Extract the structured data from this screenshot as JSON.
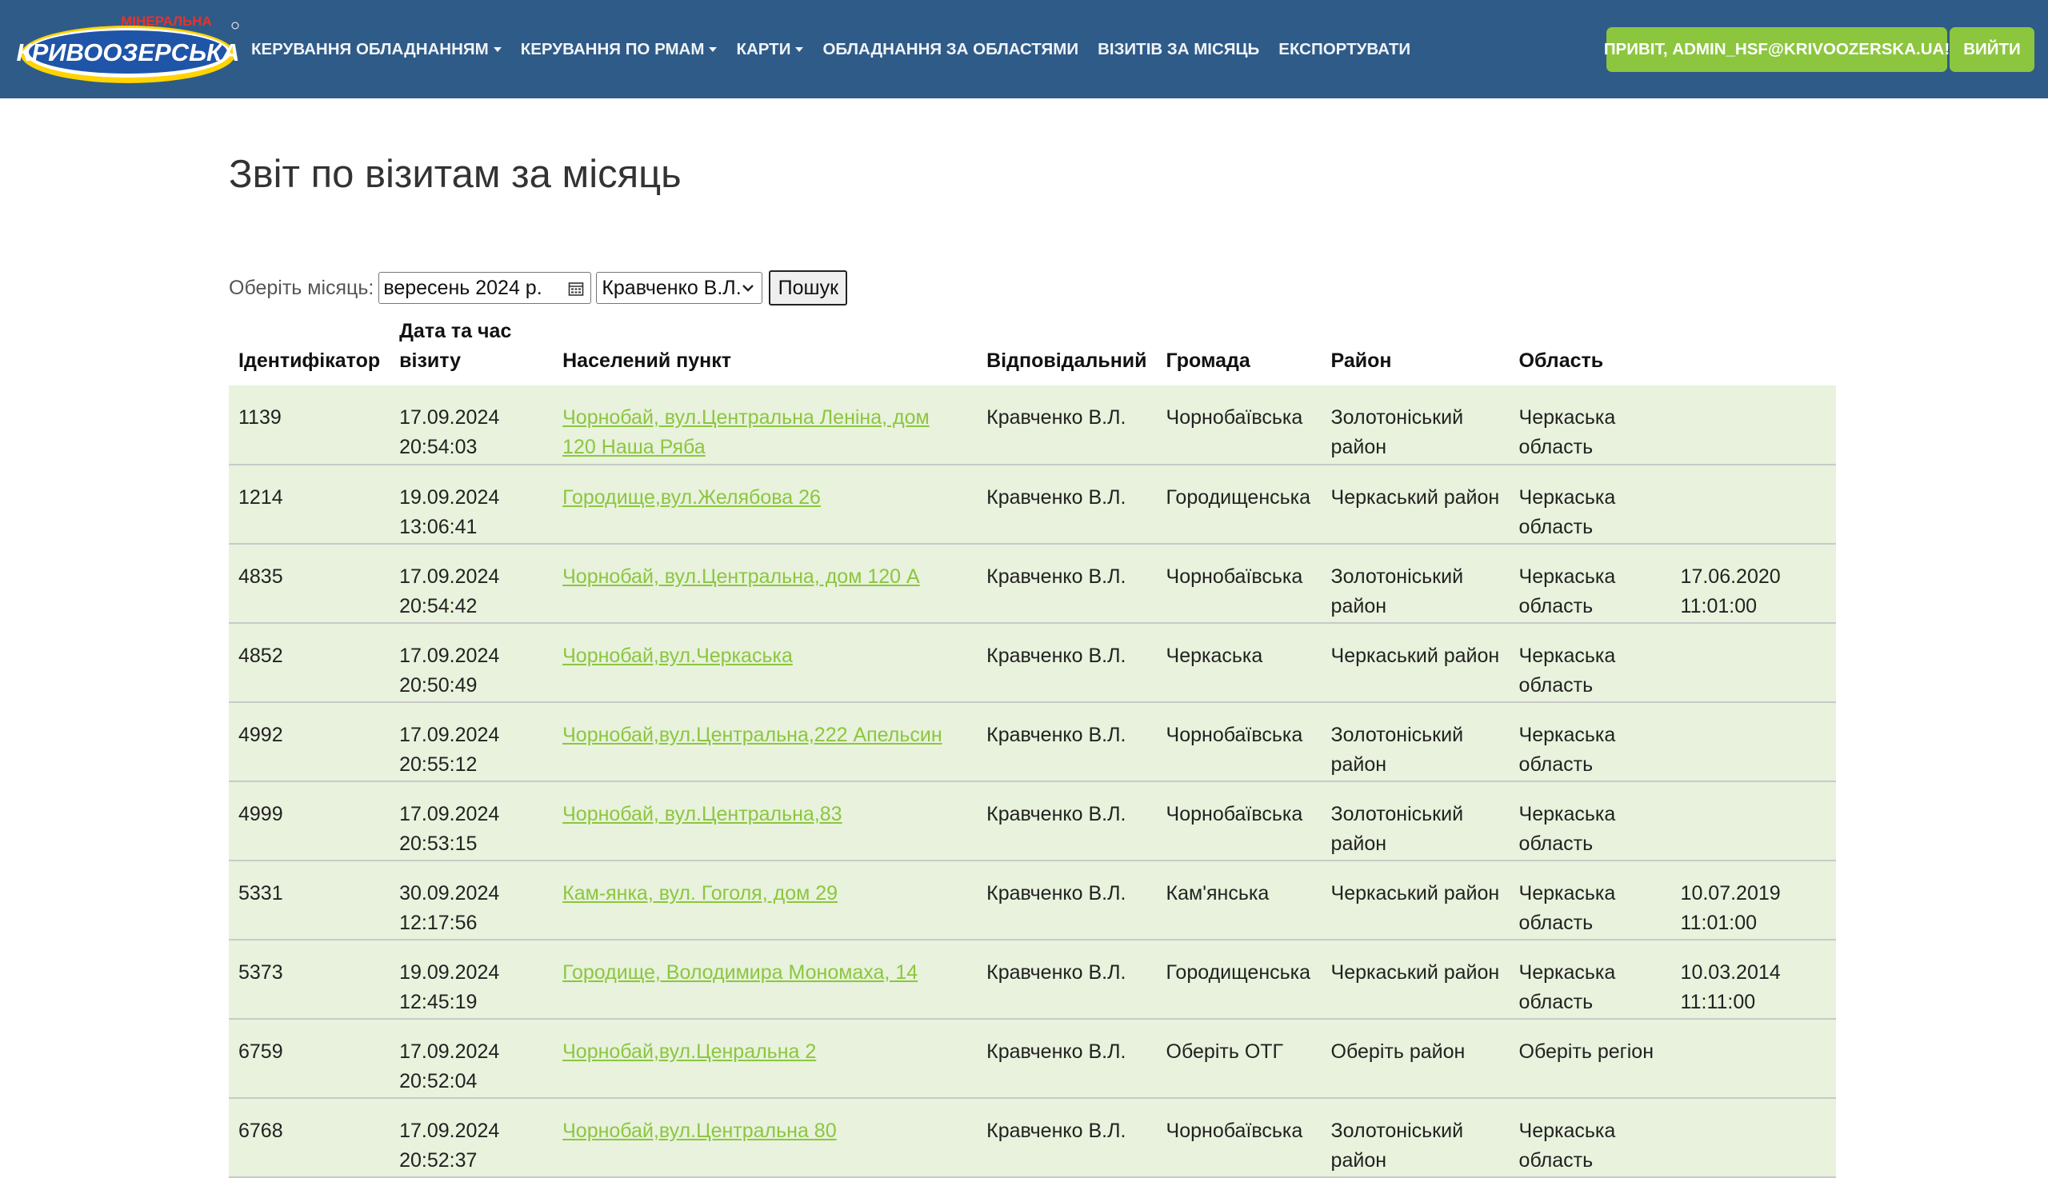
{
  "brand": {
    "small": "МІНЕРАЛЬНА",
    "big": "КРИВООЗЕРСЬКА",
    "colors": {
      "navbar": "#2f5b88",
      "accent": "#8cc63f",
      "row_bg": "#e8f2dc"
    }
  },
  "nav": [
    {
      "label": "Керування обладнанням",
      "dropdown": true
    },
    {
      "label": "Керування по РМам",
      "dropdown": true
    },
    {
      "label": "Карти",
      "dropdown": true
    },
    {
      "label": "Обладнання за областями",
      "dropdown": false
    },
    {
      "label": "Візитів за місяць",
      "dropdown": false
    },
    {
      "label": "Експортувати",
      "dropdown": false
    }
  ],
  "user": {
    "greeting": "Привіт, admin_hsf@krivoozerska.ua!",
    "logout": "Вийти"
  },
  "page_title": "Звіт по візитам за місяць",
  "filter": {
    "label": "Оберіть місяць:",
    "month_value": "вересень 2024 р.",
    "manager_value": "Кравченко В.Л.",
    "search_button": "Пошук"
  },
  "table": {
    "headers": [
      "Ідентифікатор",
      "Дата та час візиту",
      "Населений пункт",
      "Відповідальний",
      "Громада",
      "Район",
      "Область",
      ""
    ],
    "rows": [
      {
        "id": "1139",
        "date": "17.09.2024",
        "time": "20:54:03",
        "location": "Чорнобай, вул.Центральна Леніна, дом 120 Наша Ряба",
        "manager": "Кравченко В.Л.",
        "community": "Чорнобаївська",
        "district": "Золотоніський район",
        "region": "Черкаська область",
        "extra_date": "",
        "extra_time": ""
      },
      {
        "id": "1214",
        "date": "19.09.2024",
        "time": "13:06:41",
        "location": "Городище,вул.Желябова 26",
        "manager": "Кравченко В.Л.",
        "community": "Городищенська",
        "district": "Черкаський район",
        "region": "Черкаська область",
        "extra_date": "",
        "extra_time": ""
      },
      {
        "id": "4835",
        "date": "17.09.2024",
        "time": "20:54:42",
        "location": "Чорнобай, вул.Центральна, дом 120 А",
        "manager": "Кравченко В.Л.",
        "community": "Чорнобаївська",
        "district": "Золотоніський район",
        "region": "Черкаська область",
        "extra_date": "17.06.2020",
        "extra_time": "11:01:00"
      },
      {
        "id": "4852",
        "date": "17.09.2024",
        "time": "20:50:49",
        "location": "Чорнобай,вул.Черкаська",
        "manager": "Кравченко В.Л.",
        "community": "Черкаська",
        "district": "Черкаський район",
        "region": "Черкаська область",
        "extra_date": "",
        "extra_time": ""
      },
      {
        "id": "4992",
        "date": "17.09.2024",
        "time": "20:55:12",
        "location": "Чорнобай,вул.Центральна,222 Апельсин",
        "manager": "Кравченко В.Л.",
        "community": "Чорнобаївська",
        "district": "Золотоніський район",
        "region": "Черкаська область",
        "extra_date": "",
        "extra_time": ""
      },
      {
        "id": "4999",
        "date": "17.09.2024",
        "time": "20:53:15",
        "location": "Чорнобай, вул.Центральна,83",
        "manager": "Кравченко В.Л.",
        "community": "Чорнобаївська",
        "district": "Золотоніський район",
        "region": "Черкаська область",
        "extra_date": "",
        "extra_time": ""
      },
      {
        "id": "5331",
        "date": "30.09.2024",
        "time": "12:17:56",
        "location": "Кам-янка, вул. Гоголя, дом 29",
        "manager": "Кравченко В.Л.",
        "community": "Кам'янська",
        "district": "Черкаський район",
        "region": "Черкаська область",
        "extra_date": "10.07.2019",
        "extra_time": "11:01:00"
      },
      {
        "id": "5373",
        "date": "19.09.2024",
        "time": "12:45:19",
        "location": "Городище, Володимира Мономаха, 14",
        "manager": "Кравченко В.Л.",
        "community": "Городищенська",
        "district": "Черкаський район",
        "region": "Черкаська область",
        "extra_date": "10.03.2014",
        "extra_time": "11:11:00"
      },
      {
        "id": "6759",
        "date": "17.09.2024",
        "time": "20:52:04",
        "location": "Чорнобай,вул.Ценральна 2",
        "manager": "Кравченко В.Л.",
        "community": "Оберіть ОТГ",
        "district": "Оберіть район",
        "region": "Оберіть регіон",
        "extra_date": "",
        "extra_time": ""
      },
      {
        "id": "6768",
        "date": "17.09.2024",
        "time": "20:52:37",
        "location": "Чорнобай,вул.Центральна 80",
        "manager": "Кравченко В.Л.",
        "community": "Чорнобаївська",
        "district": "Золотоніський район",
        "region": "Черкаська область",
        "extra_date": "",
        "extra_time": ""
      }
    ]
  }
}
